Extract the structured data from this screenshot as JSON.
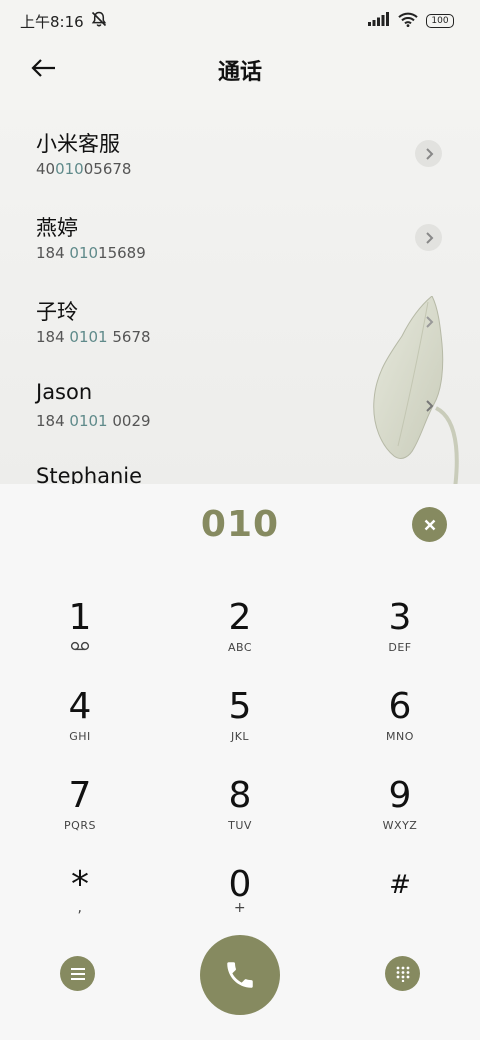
{
  "status_bar": {
    "time": "上午8:16",
    "battery": "100"
  },
  "header": {
    "title": "通话"
  },
  "contacts": [
    {
      "name": "小米客服",
      "number_pre": "40",
      "number_match": "010",
      "number_post": "05678"
    },
    {
      "name": "燕婷",
      "number_pre": "184 ",
      "number_match": "010",
      "number_post": "15689"
    },
    {
      "name": "子玲",
      "number_pre": "184 ",
      "number_match": "0101",
      "number_post": " 5678"
    },
    {
      "name": "Jason",
      "number_pre": "184 ",
      "number_match": "0101",
      "number_post": " 0029"
    },
    {
      "name": "Stephanie",
      "number_pre": "",
      "number_match": "",
      "number_post": ""
    }
  ],
  "dialer": {
    "typed_number": "010",
    "keys": [
      {
        "digit": "1",
        "sub": "voicemail-icon"
      },
      {
        "digit": "2",
        "sub": "ABC"
      },
      {
        "digit": "3",
        "sub": "DEF"
      },
      {
        "digit": "4",
        "sub": "GHI"
      },
      {
        "digit": "5",
        "sub": "JKL"
      },
      {
        "digit": "6",
        "sub": "MNO"
      },
      {
        "digit": "7",
        "sub": "PQRS"
      },
      {
        "digit": "8",
        "sub": "TUV"
      },
      {
        "digit": "9",
        "sub": "WXYZ"
      },
      {
        "digit": "*",
        "sub": ","
      },
      {
        "digit": "0",
        "sub": "+"
      },
      {
        "digit": "#",
        "sub": ""
      }
    ]
  },
  "colors": {
    "accent": "#868a60",
    "match_highlight": "#5f8a8a",
    "background": "#f4f4f2"
  }
}
